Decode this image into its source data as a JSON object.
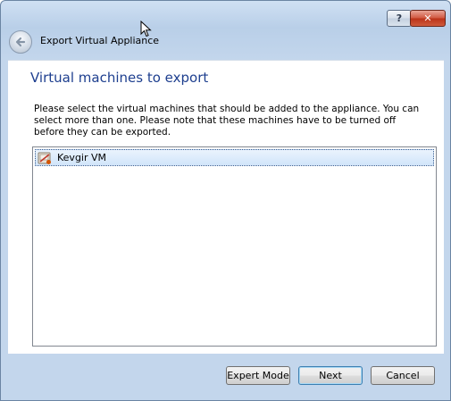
{
  "titlebar": {
    "help_label": "?",
    "close_label": "✕"
  },
  "header": {
    "title": "Export Virtual Appliance"
  },
  "page": {
    "title": "Virtual machines to export",
    "description": "Please select the virtual machines that should be added to the appliance. You can select more than one. Please note that these machines have to be turned off before they can be exported."
  },
  "vm_list": {
    "items": [
      {
        "name": "Kevgir VM",
        "icon": "virtualbox-vm-icon",
        "selected": true
      }
    ]
  },
  "buttons": {
    "expert_mode": "Expert Mode",
    "next": "Next",
    "cancel": "Cancel"
  }
}
